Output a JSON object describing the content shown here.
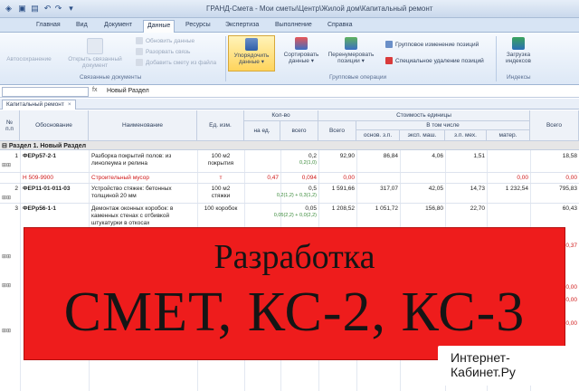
{
  "window": {
    "title": "ГРАНД-Смета - Мои сметы\\Центр\\Жилой дом\\Капитальный ремонт"
  },
  "tabs": [
    "Главная",
    "Вид",
    "Документ",
    "Данные",
    "Ресурсы",
    "Экспертиза",
    "Выполнение",
    "Справка"
  ],
  "ribbon": {
    "autosave": "Автосохранение",
    "open_linked": [
      "Открыть связанный",
      "документ"
    ],
    "group_linked": "Связанные документы",
    "small_disabled": [
      "Обновить данные",
      "Разорвать связь",
      "Добавить смету из файла"
    ],
    "sort_label": [
      "Упорядочить",
      "данные"
    ],
    "order_label": [
      "Сортировать",
      "данные"
    ],
    "renumber_label": [
      "Перенумеровать",
      "позиции"
    ],
    "group_change": "Групповое изменение позиций",
    "special_delete": "Специальное удаление позиций",
    "group_ops": "Групповые операции",
    "load_idx": [
      "Загрузка",
      "индексов"
    ],
    "group_idx": "Индексы"
  },
  "formula_bar": {
    "fx": "fx",
    "value": "Новый Раздел"
  },
  "doc_tab": "Капитальный ремонт",
  "table": {
    "headers": {
      "n": [
        "№",
        "п.п"
      ],
      "basis": "Обоснование",
      "name": "Наименование",
      "unit": "Ед. изм.",
      "qty": "Кол-во",
      "qty_per": "на ед.",
      "qty_total": "всего",
      "unit_cost": "Стоимость единицы",
      "total": "Всего",
      "incl": "В том числе",
      "osn": "основ. з.п.",
      "exp": "эксп. маш.",
      "zpm": "з.п. мех.",
      "mat": "матер.",
      "grand": "Всего"
    },
    "section_title": "Раздел 1. Новый Раздел",
    "rows": [
      {
        "n": "1",
        "code": "ФЕРр57-2-1",
        "name": [
          "Разборка покрытий полов: из",
          "линолеума и релина"
        ],
        "unit": [
          "100 м2",
          "покрытия"
        ],
        "per": "",
        "qty": "0,2",
        "qty2": "0,2(1,0)",
        "total": "92,90",
        "osn": "86,84",
        "exp": "4,06",
        "zpm": "1,51",
        "mat": "",
        "grand": "18,58"
      },
      {
        "n": "",
        "code": "Н 509-9900",
        "name": [
          "Строительный мусор"
        ],
        "unit": [
          "т"
        ],
        "per": "0,47",
        "qty": "0,094",
        "qty2": "",
        "total": "0,00",
        "osn": "",
        "exp": "",
        "zpm": "",
        "mat": "0,00",
        "grand": "0,00"
      },
      {
        "n": "2",
        "code": "ФЕР11-01-011-03",
        "name": [
          "Устройство стяжек: бетонных",
          "толщиной 20 мм"
        ],
        "unit": [
          "100 м2",
          "стяжки"
        ],
        "per": "",
        "qty": "0,5",
        "qty2": "0,2(1,2) + 0,3(1,2)",
        "total": "1 591,66",
        "osn": "317,07",
        "exp": "42,05",
        "zpm": "14,73",
        "mat": "1 232,54",
        "grand": "795,83"
      },
      {
        "n": "3",
        "code": "ФЕРр56-1-1",
        "name": [
          "Демонтаж оконных коробок: в",
          "каменных стенах с отбивкой",
          "штукатурки в откосах"
        ],
        "unit": [
          "100 коробок"
        ],
        "per": "",
        "qty": "0,05",
        "qty2": "0,05(2,2) + 0,0(2,2)",
        "total": "1 208,52",
        "osn": "1 051,72",
        "exp": "156,80",
        "zpm": "22,70",
        "mat": "",
        "grand": "60,43"
      }
    ],
    "partial_right": [
      "30,37",
      "0,00",
      "0,00",
      "0,00"
    ]
  },
  "banner": {
    "line1": "Разработка",
    "line2": "СМЕТ, КС-2, КС-3"
  },
  "watermark": [
    "Интернет-",
    "Кабинет.Ру"
  ],
  "colors": {
    "banner": "#ee1c1c",
    "red_text": "#d01818",
    "ribbon_highlight": "#ffd45c"
  }
}
